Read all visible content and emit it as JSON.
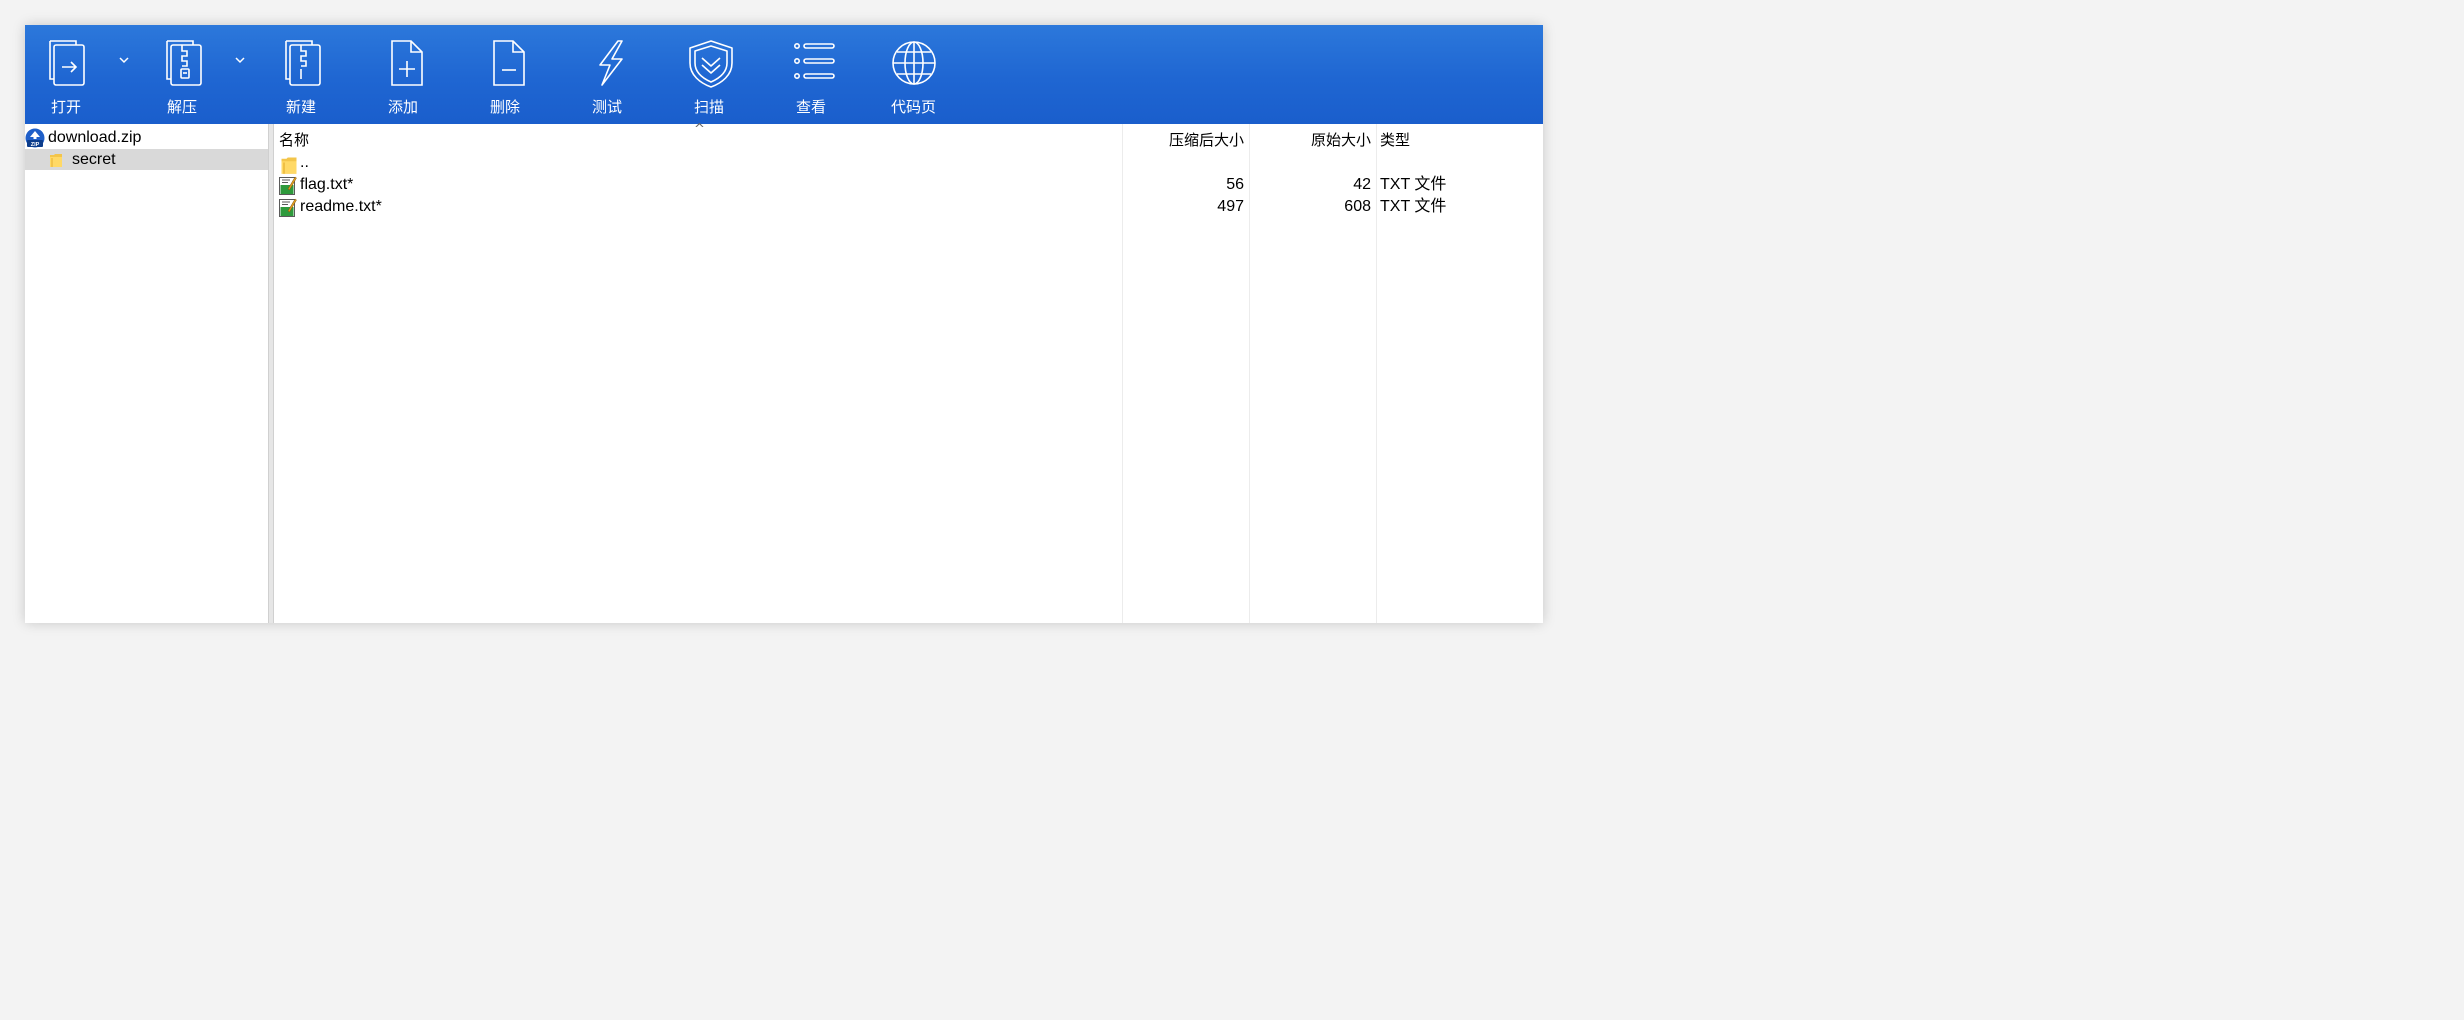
{
  "toolbar": {
    "buttons": [
      {
        "label": "打开"
      },
      {
        "label": "解压"
      },
      {
        "label": "新建"
      },
      {
        "label": "添加"
      },
      {
        "label": "删除"
      },
      {
        "label": "测试"
      },
      {
        "label": "扫描"
      },
      {
        "label": "查看"
      },
      {
        "label": "代码页"
      }
    ]
  },
  "tree": {
    "root": "download.zip",
    "root_icon_text": "ZIP",
    "child": "secret"
  },
  "columns": {
    "name": "名称",
    "compressed": "压缩后大小",
    "original": "原始大小",
    "type": "类型",
    "sort_indicator": "^"
  },
  "files": [
    {
      "name": "..",
      "compressed": "",
      "original": "",
      "type": ""
    },
    {
      "name": "flag.txt*",
      "compressed": "56",
      "original": "42",
      "type": "TXT 文件"
    },
    {
      "name": "readme.txt*",
      "compressed": "497",
      "original": "608",
      "type": "TXT 文件"
    }
  ],
  "colors": {
    "toolbar": "#1f66d2",
    "selection": "#d9d9d9"
  }
}
